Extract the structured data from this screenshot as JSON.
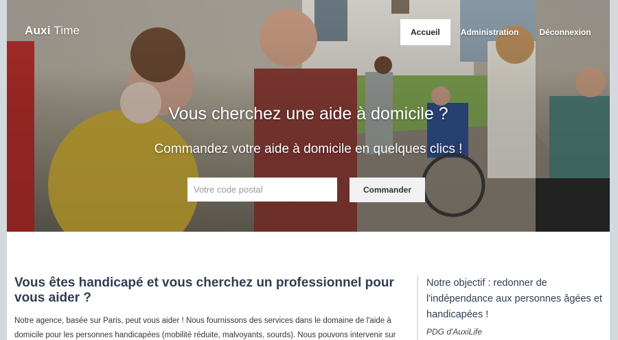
{
  "brand": {
    "name_bold": "Auxi",
    "name_light": "Time"
  },
  "nav": {
    "items": [
      {
        "label": "Accueil",
        "active": true
      },
      {
        "label": "Administration",
        "active": false
      },
      {
        "label": "Déconnexion",
        "active": false
      }
    ]
  },
  "hero": {
    "title": "Vous cherchez une aide à domicile ?",
    "subtitle": "Commandez votre aide à domicile en quelques clics !",
    "postal_placeholder": "Votre code postal",
    "order_button": "Commander"
  },
  "main": {
    "title": "Vous êtes handicapé et vous cherchez un professionnel pour vous aider ?",
    "text": "Notre agence, basée sur Paris, peut vous aider ! Nous fournissons des services dans le domaine de l'aide à domicile pour les personnes handicapées (mobilité réduite, malvoyants, sourds). Nous pouvons intervenir sur"
  },
  "aside": {
    "quote": "Notre objectif : redonner de l'indépendance aux personnes âgées et handicapées !",
    "author": "PDG d'AuxiLife"
  }
}
